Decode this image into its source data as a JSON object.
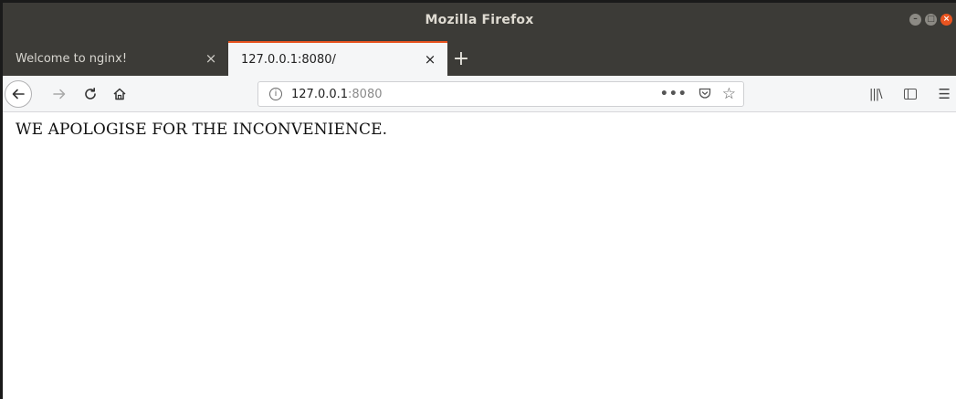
{
  "window": {
    "title": "Mozilla Firefox"
  },
  "tabs": [
    {
      "label": "Welcome to nginx!",
      "active": false
    },
    {
      "label": "127.0.0.1:8080/",
      "active": true
    }
  ],
  "toolbar": {
    "url_host": "127.0.0.1",
    "url_port": ":8080",
    "page_actions_label": "•••"
  },
  "page": {
    "message": "WE APOLOGISE FOR THE INCONVENIENCE."
  },
  "colors": {
    "accent": "#e95420",
    "titlebar": "#3c3b37",
    "toolbar": "#f5f6f7"
  },
  "icons": [
    "back-icon",
    "forward-icon",
    "reload-icon",
    "home-icon",
    "info-icon",
    "pocket-icon",
    "bookmark-star-icon",
    "library-icon",
    "sidebar-icon",
    "menu-icon",
    "new-tab-icon",
    "close-icon"
  ]
}
